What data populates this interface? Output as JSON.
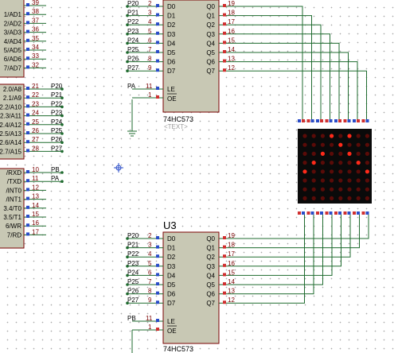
{
  "mcu_left": {
    "top_pins": [
      {
        "label": "",
        "num": "39"
      },
      {
        "label": "1/AD1",
        "num": "38"
      },
      {
        "label": "2/AD2",
        "num": "37"
      },
      {
        "label": "3/AD3",
        "num": "36"
      },
      {
        "label": "4/AD4",
        "num": "35"
      },
      {
        "label": "5/AD5",
        "num": "34"
      },
      {
        "label": "6/AD6",
        "num": "33"
      },
      {
        "label": "7/AD7",
        "num": "32"
      }
    ],
    "p2_pins": [
      {
        "label": "2.0/A8",
        "num": "21",
        "net": "P20"
      },
      {
        "label": "2.1/A9",
        "num": "22",
        "net": "P21"
      },
      {
        "label": "2.2/A10",
        "num": "23",
        "net": "P22"
      },
      {
        "label": "2.3/A11",
        "num": "24",
        "net": "P23"
      },
      {
        "label": "2.4/A12",
        "num": "25",
        "net": "P24"
      },
      {
        "label": "2.5/A13",
        "num": "26",
        "net": "P25"
      },
      {
        "label": "2.6/A14",
        "num": "27",
        "net": "P26"
      },
      {
        "label": "2.7/A15",
        "num": "28",
        "net": "P27"
      }
    ],
    "p3_pins": [
      {
        "label": "/RXD",
        "num": "10",
        "net": "PB"
      },
      {
        "label": "/TXD",
        "num": "11",
        "net": "PA"
      },
      {
        "label": "/INT0",
        "num": "12",
        "net": ""
      },
      {
        "label": "/INT1",
        "num": "13",
        "net": ""
      },
      {
        "label": "3.4/T0",
        "num": "14",
        "net": ""
      },
      {
        "label": "3.5/T1",
        "num": "15",
        "net": ""
      },
      {
        "label": "6/WR",
        "num": "16",
        "net": ""
      },
      {
        "label": "7/RD",
        "num": "17",
        "net": ""
      }
    ]
  },
  "chip_top": {
    "name": "74HC573",
    "text_placeholder": "<TEXT>",
    "inputs": [
      {
        "net": "P20",
        "num": "2",
        "pin": "D0"
      },
      {
        "net": "P21",
        "num": "3",
        "pin": "D1"
      },
      {
        "net": "P22",
        "num": "4",
        "pin": "D2"
      },
      {
        "net": "P23",
        "num": "5",
        "pin": "D3"
      },
      {
        "net": "P24",
        "num": "6",
        "pin": "D4"
      },
      {
        "net": "P25",
        "num": "7",
        "pin": "D5"
      },
      {
        "net": "P26",
        "num": "8",
        "pin": "D6"
      },
      {
        "net": "P27",
        "num": "9",
        "pin": "D7"
      }
    ],
    "outputs": [
      {
        "pin": "Q0",
        "num": "19"
      },
      {
        "pin": "Q1",
        "num": "18"
      },
      {
        "pin": "Q2",
        "num": "17"
      },
      {
        "pin": "Q3",
        "num": "16"
      },
      {
        "pin": "Q4",
        "num": "15"
      },
      {
        "pin": "Q5",
        "num": "14"
      },
      {
        "pin": "Q6",
        "num": "13"
      },
      {
        "pin": "Q7",
        "num": "12"
      }
    ],
    "le": {
      "net": "PA",
      "num": "11",
      "pin": "LE"
    },
    "oe": {
      "num": "1",
      "pin": "OE"
    }
  },
  "chip_bottom": {
    "ref": "U3",
    "name": "74HC573",
    "inputs": [
      {
        "net": "P20",
        "num": "2",
        "pin": "D0"
      },
      {
        "net": "P21",
        "num": "3",
        "pin": "D1"
      },
      {
        "net": "P22",
        "num": "4",
        "pin": "D2"
      },
      {
        "net": "P23",
        "num": "5",
        "pin": "D3"
      },
      {
        "net": "P24",
        "num": "6",
        "pin": "D4"
      },
      {
        "net": "P25",
        "num": "7",
        "pin": "D5"
      },
      {
        "net": "P26",
        "num": "8",
        "pin": "D6"
      },
      {
        "net": "P27",
        "num": "9",
        "pin": "D7"
      }
    ],
    "outputs": [
      {
        "pin": "Q0",
        "num": "19"
      },
      {
        "pin": "Q1",
        "num": "18"
      },
      {
        "pin": "Q2",
        "num": "17"
      },
      {
        "pin": "Q3",
        "num": "16"
      },
      {
        "pin": "Q4",
        "num": "15"
      },
      {
        "pin": "Q5",
        "num": "14"
      },
      {
        "pin": "Q6",
        "num": "13"
      },
      {
        "pin": "Q7",
        "num": "12"
      }
    ],
    "le": {
      "net": "PB",
      "num": "11",
      "pin": "LE"
    },
    "oe": {
      "num": "1",
      "pin": "OE"
    }
  },
  "led_matrix": {
    "rows": 8,
    "cols": 8,
    "lit": [
      [
        0,
        0,
        0,
        1,
        0,
        1,
        0,
        0
      ],
      [
        0,
        0,
        0,
        0,
        1,
        0,
        0,
        0
      ],
      [
        0,
        0,
        1,
        0,
        0,
        1,
        0,
        0
      ],
      [
        0,
        1,
        0,
        0,
        0,
        0,
        1,
        0
      ],
      [
        1,
        0,
        0,
        0,
        0,
        0,
        0,
        1
      ],
      [
        0,
        0,
        0,
        0,
        0,
        0,
        0,
        0
      ],
      [
        0,
        0,
        0,
        0,
        0,
        0,
        0,
        0
      ],
      [
        0,
        0,
        0,
        0,
        0,
        0,
        0,
        0
      ]
    ]
  },
  "colors": {
    "wire": "#1f6b2f",
    "chip_fill": "#c8c8b4",
    "chip_border": "#7a0000",
    "pin_in_marker": "#2a4cc8",
    "pin_out_marker": "#d03030",
    "matrix_bg": "#0a0a0a",
    "led_on": "#ff2a1a",
    "led_off": "#5a0b08"
  }
}
